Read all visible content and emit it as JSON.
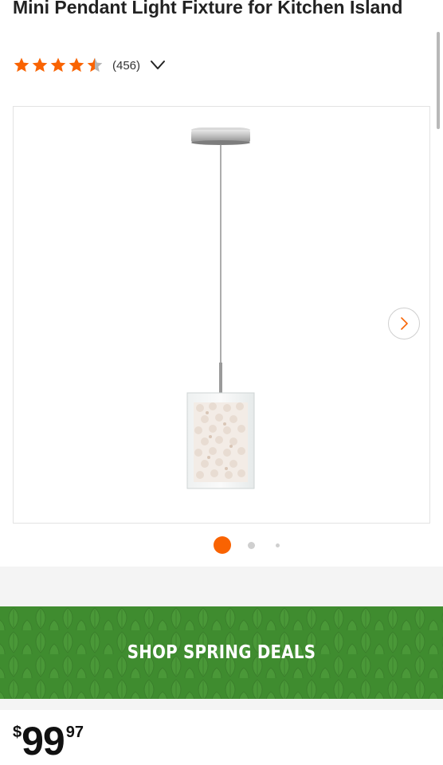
{
  "product": {
    "title": "Mini Pendant Light Fixture for Kitchen Island",
    "rating": 4.5,
    "rating_max": 5,
    "review_count": "(456)"
  },
  "gallery": {
    "current_index": 1,
    "image_count": 3
  },
  "promo": {
    "label": "SHOP SPRING DEALS",
    "bg_color": "#3d8a2e"
  },
  "price": {
    "currency": "$",
    "whole": "99",
    "cents": "97"
  },
  "colors": {
    "accent": "#f96302",
    "star": "#f96302"
  },
  "icons": {
    "rating_toggle": "chevron-down-icon",
    "gallery_next": "chevron-right-icon"
  }
}
